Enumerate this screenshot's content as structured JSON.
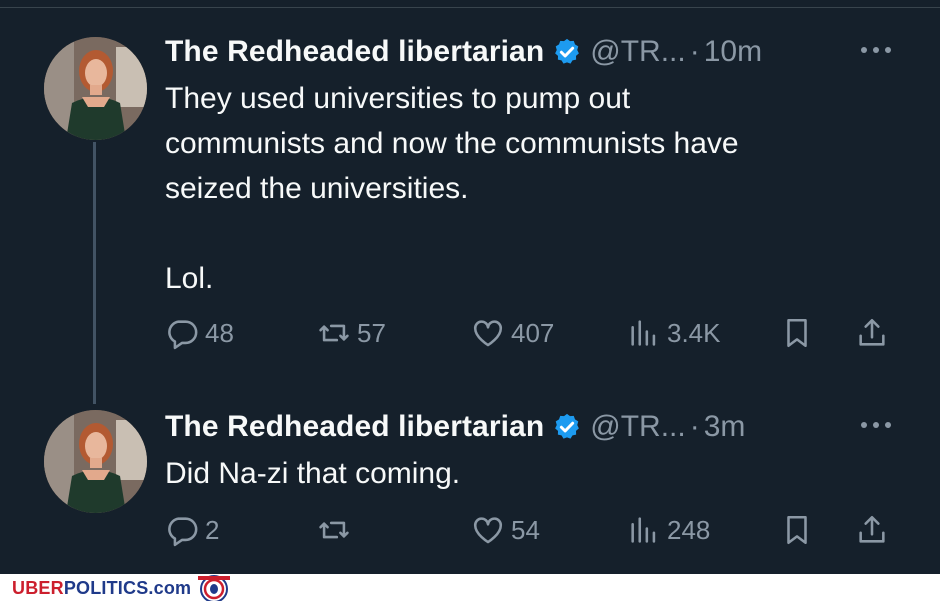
{
  "tweets": [
    {
      "author_name": "The Redheaded libertarian",
      "handle": "@TR...",
      "separator": "·",
      "time": "10m",
      "text": "They used universities to pump out\ncommunists and now the communists have\nseized the universities.\n\nLol.",
      "replies": "48",
      "retweets": "57",
      "likes": "407",
      "views": "3.4K"
    },
    {
      "author_name": "The Redheaded libertarian",
      "handle": "@TR...",
      "separator": "·",
      "time": "3m",
      "text": "Did Na-zi that coming.",
      "replies": "2",
      "retweets": "",
      "likes": "54",
      "views": "248"
    }
  ],
  "footer": {
    "brand_part1": "UBER",
    "brand_part2": "POLITICS.com"
  },
  "colors": {
    "background": "#15202b",
    "text": "#f7f9f9",
    "muted": "#8b98a5",
    "verified": "#1d9bf0",
    "brand_red": "#cc1f2d",
    "brand_blue": "#1f3a8a"
  },
  "icons": [
    "verified-badge-icon",
    "more-icon",
    "reply-icon",
    "retweet-icon",
    "like-icon",
    "views-icon",
    "bookmark-icon",
    "share-icon",
    "lion-logo-icon"
  ]
}
